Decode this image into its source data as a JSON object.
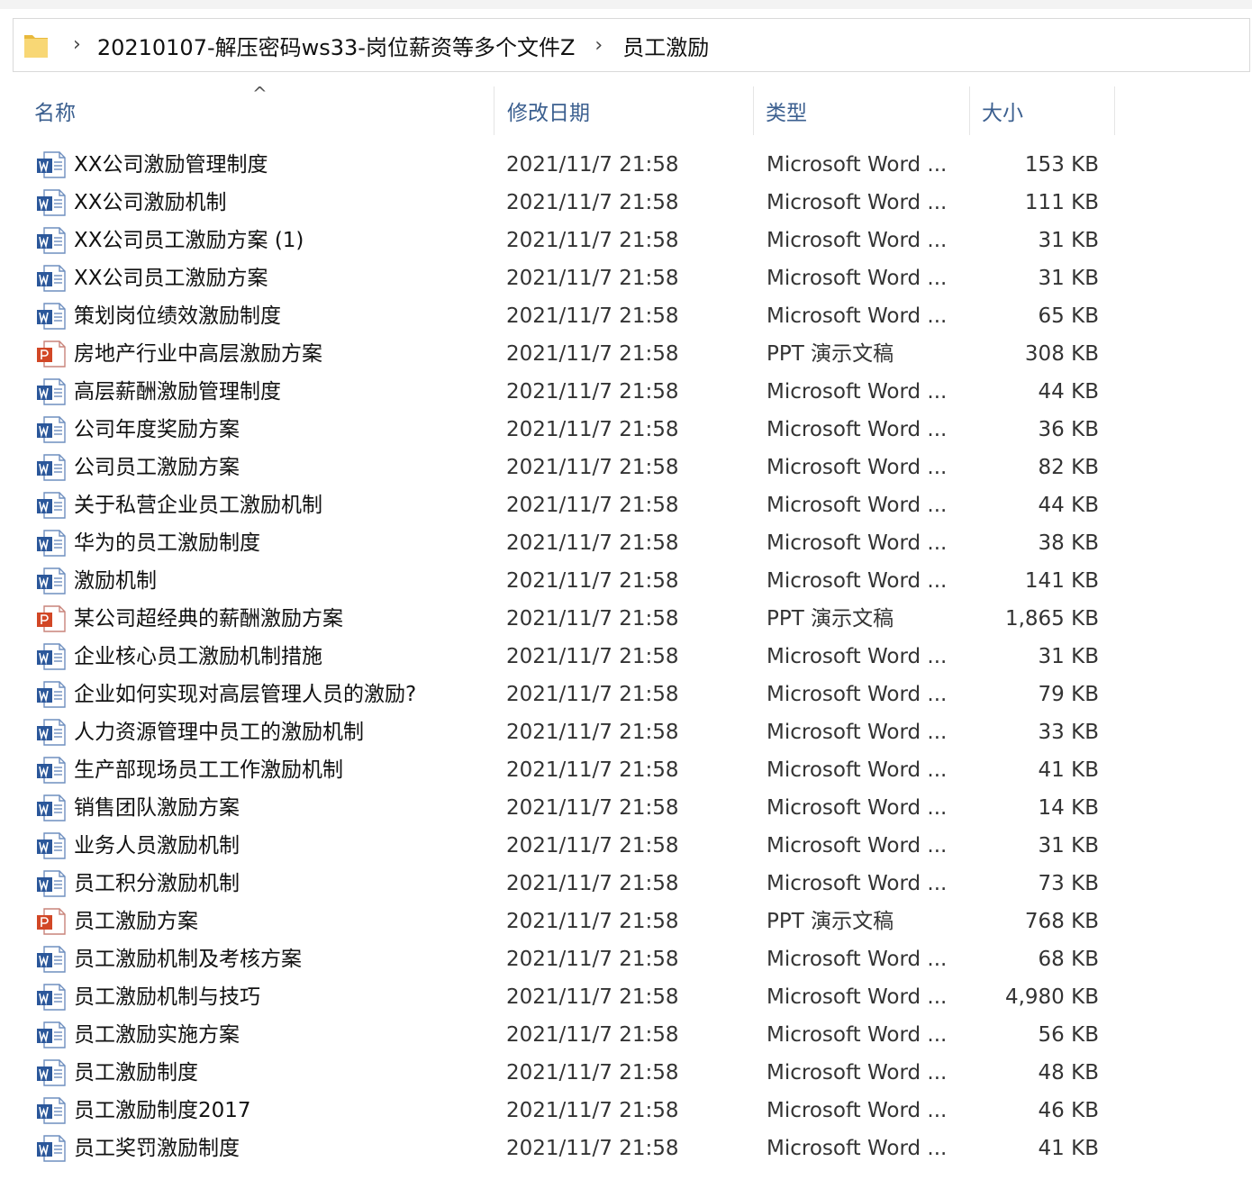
{
  "breadcrumb": {
    "folder_icon": "folder-icon",
    "separator": "›",
    "segments": [
      "20210107-解压密码ws33-岗位薪资等多个文件Z",
      "员工激励"
    ]
  },
  "columns": {
    "name": "名称",
    "date": "修改日期",
    "type": "类型",
    "size": "大小",
    "sort_indicator": "^"
  },
  "files": [
    {
      "name": "XX公司激励管理制度",
      "date": "2021/11/7 21:58",
      "type": "Microsoft Word ...",
      "size": "153 KB",
      "icon": "word"
    },
    {
      "name": "XX公司激励机制",
      "date": "2021/11/7 21:58",
      "type": "Microsoft Word ...",
      "size": "111 KB",
      "icon": "word"
    },
    {
      "name": "XX公司员工激励方案 (1)",
      "date": "2021/11/7 21:58",
      "type": "Microsoft Word ...",
      "size": "31 KB",
      "icon": "word"
    },
    {
      "name": "XX公司员工激励方案",
      "date": "2021/11/7 21:58",
      "type": "Microsoft Word ...",
      "size": "31 KB",
      "icon": "word"
    },
    {
      "name": "策划岗位绩效激励制度",
      "date": "2021/11/7 21:58",
      "type": "Microsoft Word ...",
      "size": "65 KB",
      "icon": "word"
    },
    {
      "name": "房地产行业中高层激励方案",
      "date": "2021/11/7 21:58",
      "type": "PPT 演示文稿",
      "size": "308 KB",
      "icon": "ppt"
    },
    {
      "name": "高层薪酬激励管理制度",
      "date": "2021/11/7 21:58",
      "type": "Microsoft Word ...",
      "size": "44 KB",
      "icon": "word"
    },
    {
      "name": "公司年度奖励方案",
      "date": "2021/11/7 21:58",
      "type": "Microsoft Word ...",
      "size": "36 KB",
      "icon": "word"
    },
    {
      "name": "公司员工激励方案",
      "date": "2021/11/7 21:58",
      "type": "Microsoft Word ...",
      "size": "82 KB",
      "icon": "word"
    },
    {
      "name": "关于私营企业员工激励机制",
      "date": "2021/11/7 21:58",
      "type": "Microsoft Word ...",
      "size": "44 KB",
      "icon": "word"
    },
    {
      "name": "华为的员工激励制度",
      "date": "2021/11/7 21:58",
      "type": "Microsoft Word ...",
      "size": "38 KB",
      "icon": "word"
    },
    {
      "name": "激励机制",
      "date": "2021/11/7 21:58",
      "type": "Microsoft Word ...",
      "size": "141 KB",
      "icon": "word"
    },
    {
      "name": "某公司超经典的薪酬激励方案",
      "date": "2021/11/7 21:58",
      "type": "PPT 演示文稿",
      "size": "1,865 KB",
      "icon": "ppt"
    },
    {
      "name": "企业核心员工激励机制措施",
      "date": "2021/11/7 21:58",
      "type": "Microsoft Word ...",
      "size": "31 KB",
      "icon": "word"
    },
    {
      "name": "企业如何实现对高层管理人员的激励?",
      "date": "2021/11/7 21:58",
      "type": "Microsoft Word ...",
      "size": "79 KB",
      "icon": "word"
    },
    {
      "name": "人力资源管理中员工的激励机制",
      "date": "2021/11/7 21:58",
      "type": "Microsoft Word ...",
      "size": "33 KB",
      "icon": "word"
    },
    {
      "name": "生产部现场员工工作激励机制",
      "date": "2021/11/7 21:58",
      "type": "Microsoft Word ...",
      "size": "41 KB",
      "icon": "word"
    },
    {
      "name": "销售团队激励方案",
      "date": "2021/11/7 21:58",
      "type": "Microsoft Word ...",
      "size": "14 KB",
      "icon": "word"
    },
    {
      "name": "业务人员激励机制",
      "date": "2021/11/7 21:58",
      "type": "Microsoft Word ...",
      "size": "31 KB",
      "icon": "word"
    },
    {
      "name": "员工积分激励机制",
      "date": "2021/11/7 21:58",
      "type": "Microsoft Word ...",
      "size": "73 KB",
      "icon": "word"
    },
    {
      "name": "员工激励方案",
      "date": "2021/11/7 21:58",
      "type": "PPT 演示文稿",
      "size": "768 KB",
      "icon": "ppt"
    },
    {
      "name": "员工激励机制及考核方案",
      "date": "2021/11/7 21:58",
      "type": "Microsoft Word ...",
      "size": "68 KB",
      "icon": "word"
    },
    {
      "name": "员工激励机制与技巧",
      "date": "2021/11/7 21:58",
      "type": "Microsoft Word ...",
      "size": "4,980 KB",
      "icon": "word"
    },
    {
      "name": "员工激励实施方案",
      "date": "2021/11/7 21:58",
      "type": "Microsoft Word ...",
      "size": "56 KB",
      "icon": "word"
    },
    {
      "name": "员工激励制度",
      "date": "2021/11/7 21:58",
      "type": "Microsoft Word ...",
      "size": "48 KB",
      "icon": "word"
    },
    {
      "name": "员工激励制度2017",
      "date": "2021/11/7 21:58",
      "type": "Microsoft Word ...",
      "size": "46 KB",
      "icon": "word"
    },
    {
      "name": "员工奖罚激励制度",
      "date": "2021/11/7 21:58",
      "type": "Microsoft Word ...",
      "size": "41 KB",
      "icon": "word"
    }
  ],
  "colors": {
    "word_blue": "#2b579a",
    "ppt_red": "#d24726",
    "folder_yellow": "#f8d775",
    "header_text": "#3b5f8f"
  }
}
